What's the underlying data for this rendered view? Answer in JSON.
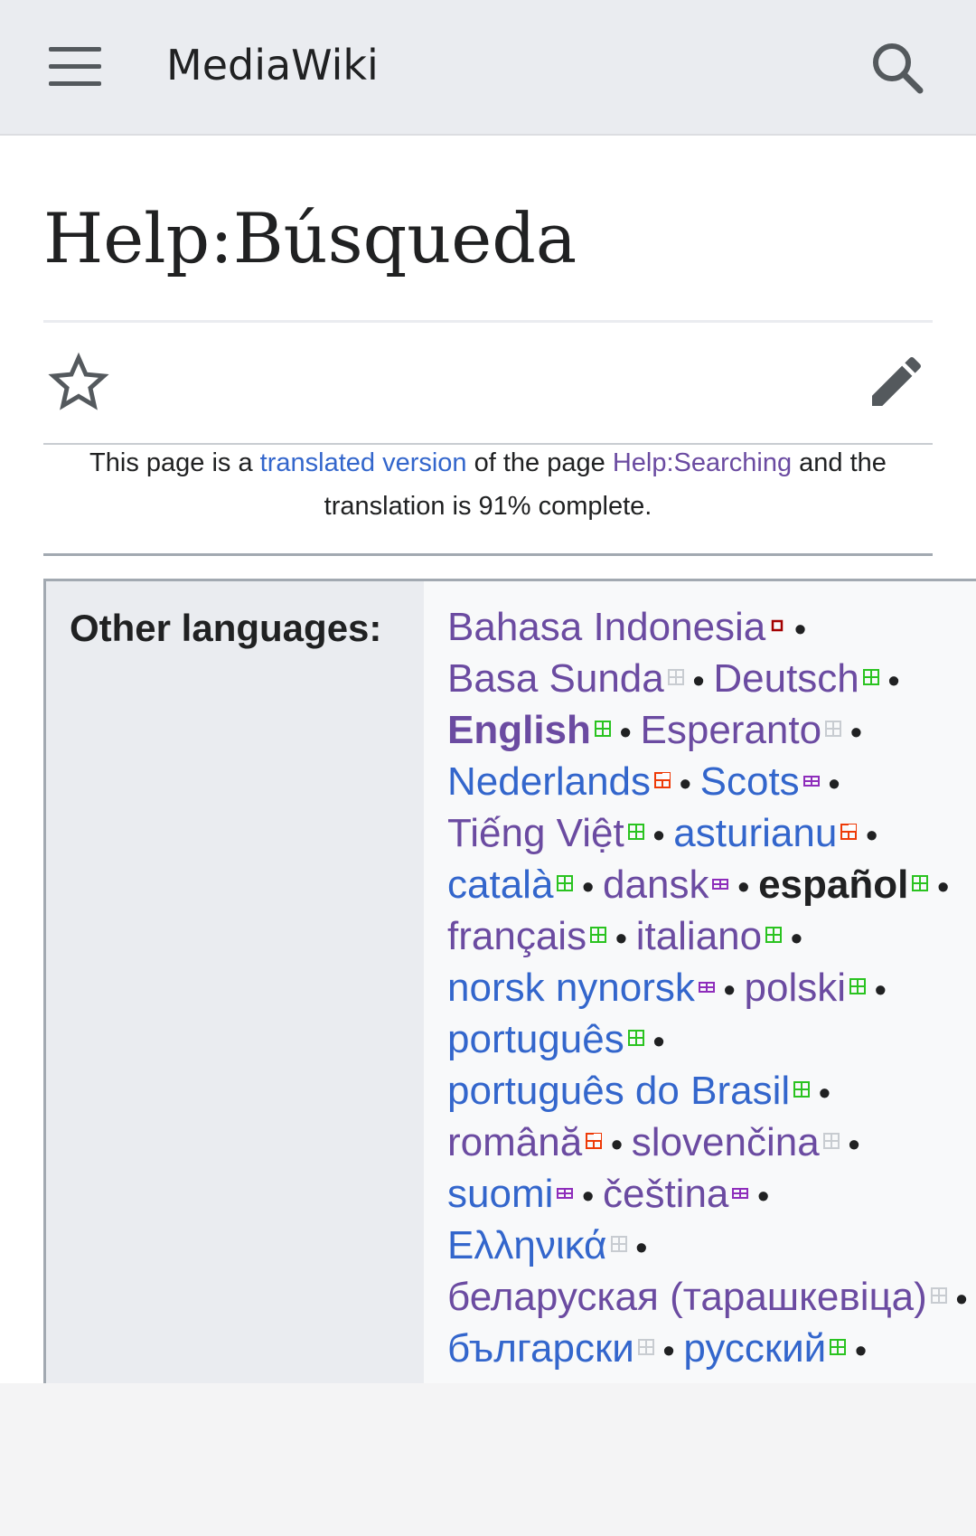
{
  "header": {
    "title": "MediaWiki",
    "menu_icon": "hamburger-menu-icon",
    "search_icon": "search-icon"
  },
  "page": {
    "title": "Help:Búsqueda"
  },
  "notice": {
    "text_before": "This page is a ",
    "link1": "translated version",
    "text_middle": " of the page ",
    "link2": "Help:Searching",
    "text_after": " and the translation is 91% complete."
  },
  "languages": {
    "label": "Other languages:",
    "colors": {
      "link_blue": "#3366cc",
      "link_visited": "#6b4ba1",
      "status_complete": "#2ac320",
      "status_partial": "#ee3a07",
      "status_low": "#a30000",
      "status_medium": "#8e2dbb",
      "status_none": "#c8ccd1"
    },
    "lines": [
      [
        {
          "name": "Bahasa Indonesia",
          "color": "purple",
          "status": "low"
        }
      ],
      [
        {
          "name": "Basa Sunda",
          "color": "purple",
          "status": "none"
        },
        {
          "name": "Deutsch",
          "color": "purple",
          "status": "complete"
        }
      ],
      [
        {
          "name": "English",
          "color": "purple",
          "status": "complete",
          "bold": true
        },
        {
          "name": "Esperanto",
          "color": "purple",
          "status": "none"
        }
      ],
      [
        {
          "name": "Nederlands",
          "color": "blue",
          "status": "partial"
        },
        {
          "name": "Scots",
          "color": "blue",
          "status": "medium"
        }
      ],
      [
        {
          "name": "Tiếng Việt",
          "color": "purple",
          "status": "complete"
        },
        {
          "name": "asturianu",
          "color": "blue",
          "status": "partial"
        }
      ],
      [
        {
          "name": "català",
          "color": "blue",
          "status": "complete"
        },
        {
          "name": "dansk",
          "color": "purple",
          "status": "medium"
        },
        {
          "name": "español",
          "color": "current",
          "status": "complete"
        }
      ],
      [
        {
          "name": "français",
          "color": "purple",
          "status": "complete"
        },
        {
          "name": "italiano",
          "color": "purple",
          "status": "complete"
        }
      ],
      [
        {
          "name": "norsk nynorsk",
          "color": "blue",
          "status": "medium"
        },
        {
          "name": "polski",
          "color": "purple",
          "status": "complete"
        }
      ],
      [
        {
          "name": "português",
          "color": "blue",
          "status": "complete"
        }
      ],
      [
        {
          "name": "português do Brasil",
          "color": "blue",
          "status": "complete"
        }
      ],
      [
        {
          "name": "română",
          "color": "purple",
          "status": "partial"
        },
        {
          "name": "slovenčina",
          "color": "purple",
          "status": "none"
        }
      ],
      [
        {
          "name": "suomi",
          "color": "blue",
          "status": "medium"
        },
        {
          "name": "čeština",
          "color": "purple",
          "status": "medium"
        }
      ],
      [
        {
          "name": "Ελληνικά",
          "color": "blue",
          "status": "none"
        }
      ],
      [
        {
          "name": "беларуская (тарашкевіца)",
          "color": "purple",
          "status": "none"
        }
      ],
      [
        {
          "name": "български",
          "color": "blue",
          "status": "none"
        },
        {
          "name": "русский",
          "color": "blue",
          "status": "complete"
        }
      ]
    ],
    "separator": "•"
  },
  "actions": {
    "watch_icon": "star-icon",
    "edit_icon": "pencil-edit-icon"
  }
}
